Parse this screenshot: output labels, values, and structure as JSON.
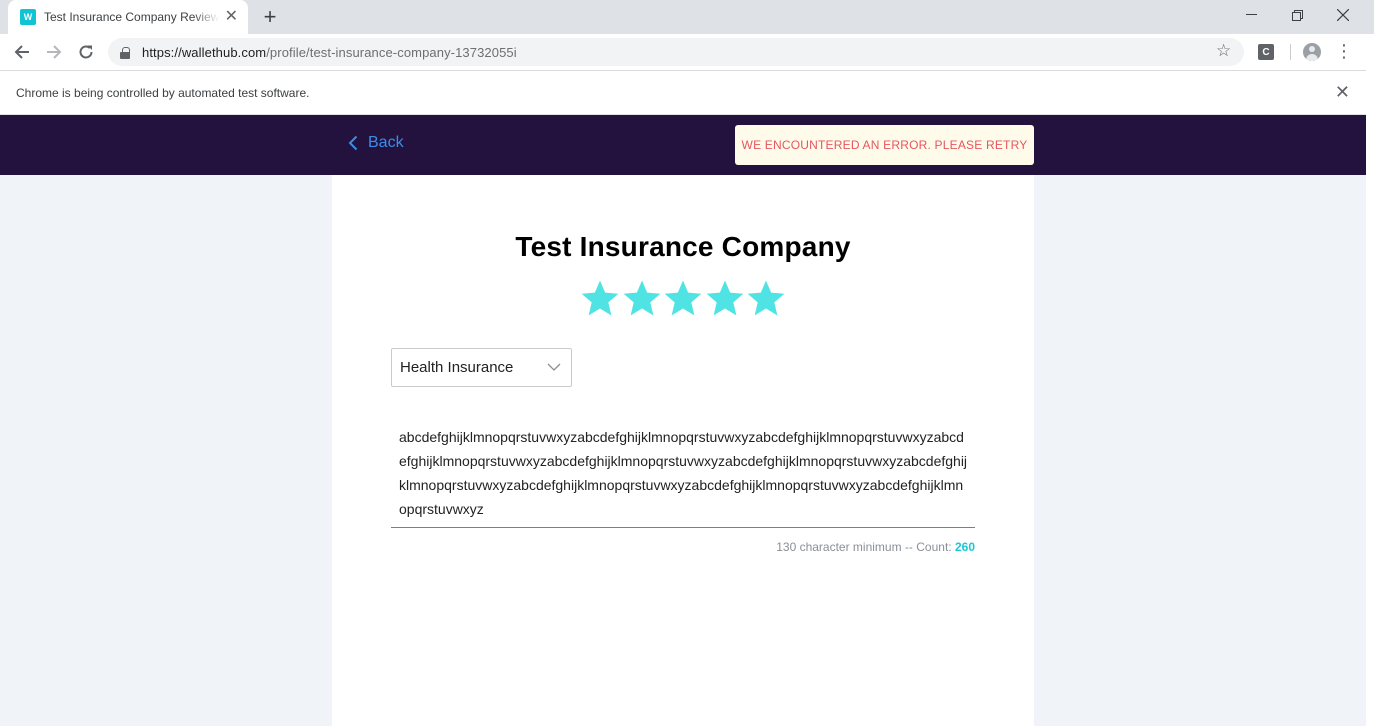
{
  "browser": {
    "tab_title": "Test Insurance Company Reviews",
    "favicon_letter": "W",
    "url_host": "https://wallethub.com",
    "url_path": "/profile/test-insurance-company-13732055i",
    "extension_letter": "C",
    "infobar_text": "Chrome is being controlled by automated test software."
  },
  "header": {
    "back_label": "Back",
    "error_message": "WE ENCOUNTERED AN ERROR. PLEASE RETRY"
  },
  "review": {
    "company_name": "Test Insurance Company",
    "rating": 5,
    "rating_max": 5,
    "star_color": "#4fe3e3",
    "category": "Health Insurance",
    "text": "abcdefghijklmnopqrstuvwxyzabcdefghijklmnopqrstuvwxyzabcdefghijklmnopqrstuvwxyzabcdefghijklmnopqrstuvwxyzabcdefghijklmnopqrstuvwxyzabcdefghijklmnopqrstuvwxyzabcdefghijklmnopqrstuvwxyzabcdefghijklmnopqrstuvwxyzabcdefghijklmnopqrstuvwxyzabcdefghijklmnopqrstuvwxyz",
    "char_min_label": "130 character minimum -- Count:",
    "char_count": "260"
  },
  "colors": {
    "header_bg": "#23123e",
    "accent": "#1ec6d3",
    "error_text": "#e8555e",
    "link": "#3c8de8"
  }
}
